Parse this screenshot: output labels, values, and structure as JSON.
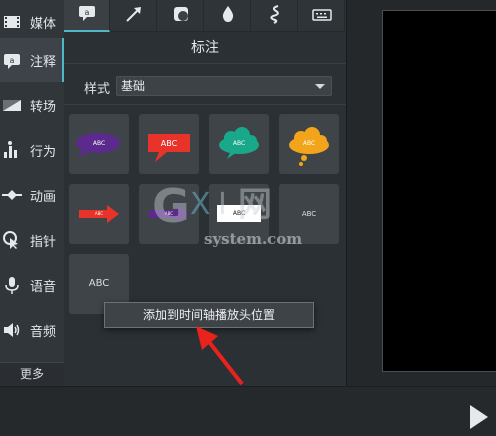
{
  "sidebar": {
    "items": [
      {
        "label": "媒体",
        "icon": "film-strip-icon"
      },
      {
        "label": "注释",
        "icon": "annotation-icon",
        "active": true
      },
      {
        "label": "转场",
        "icon": "transition-icon"
      },
      {
        "label": "行为",
        "icon": "behavior-icon"
      },
      {
        "label": "动画",
        "icon": "animation-icon"
      },
      {
        "label": "指针",
        "icon": "cursor-effect-icon"
      },
      {
        "label": "语音",
        "icon": "microphone-icon"
      },
      {
        "label": "音频",
        "icon": "speaker-icon"
      }
    ],
    "more_label": "更多"
  },
  "toolbar": {
    "tabs": [
      {
        "icon": "callout-icon",
        "active": true
      },
      {
        "icon": "arrow-icon"
      },
      {
        "icon": "shape-icon"
      },
      {
        "icon": "blur-drop-icon"
      },
      {
        "icon": "sketch-motion-icon"
      },
      {
        "icon": "keyboard-icon"
      }
    ]
  },
  "panel": {
    "title": "标注",
    "style_label": "样式",
    "style_value": "基础"
  },
  "callouts": {
    "tiles": [
      {
        "kind": "speech-oval",
        "text": "ABC",
        "color": "#5b2a8c"
      },
      {
        "kind": "speech-rect",
        "text": "ABC",
        "color": "#e8332a"
      },
      {
        "kind": "cloud",
        "text": "ABC",
        "color": "#1aa88a"
      },
      {
        "kind": "thought-cloud",
        "text": "ABC",
        "color": "#f2a51a"
      },
      {
        "kind": "arrow-red",
        "text": "ABC",
        "color": "#e8332a"
      },
      {
        "kind": "arrow-purple",
        "text": "ABC",
        "color": "#5b2a8c"
      },
      {
        "kind": "white-box",
        "text": "ABC",
        "color": "#ffffff"
      },
      {
        "kind": "plain-text",
        "text": "ABC",
        "color": "#dddddd"
      },
      {
        "kind": "plain-text-large",
        "text": "ABC",
        "color": "#dddddd"
      }
    ]
  },
  "context_menu": {
    "item_label": "添加到时间轴播放头位置"
  },
  "watermark": {
    "logo_text": "GXI网",
    "domain_text": "system.com"
  }
}
